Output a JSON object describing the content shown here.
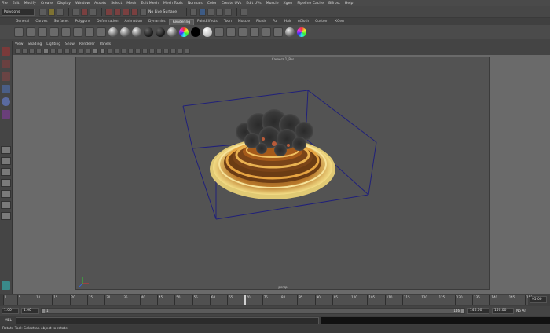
{
  "menubar": {
    "items": [
      "File",
      "Edit",
      "Modify",
      "Create",
      "Display",
      "Window",
      "Assets",
      "Select",
      "Mesh",
      "Edit Mesh",
      "Mesh Tools",
      "Normals",
      "Color",
      "Create UVs",
      "Edit UVs",
      "Muscle",
      "Xgen",
      "Pipeline Cache",
      "Bifrost",
      "Help"
    ]
  },
  "statusline": {
    "mode": "Polygons",
    "live_surface": "No Live Surface"
  },
  "shelf": {
    "tabs": [
      "General",
      "Curves",
      "Surfaces",
      "Polygons",
      "Deformation",
      "Animation",
      "Dynamics",
      "Rendering",
      "PaintEffects",
      "Toon",
      "Muscle",
      "Fluids",
      "Fur",
      "Hair",
      "nCloth",
      "Custom",
      "XGen"
    ],
    "active_tab": "Rendering"
  },
  "panel_menu": {
    "items": [
      "View",
      "Shading",
      "Lighting",
      "Show",
      "Renderer",
      "Panels"
    ]
  },
  "viewport": {
    "top_label": "Camera 1_Pos",
    "camera_name": "persp"
  },
  "time_slider": {
    "ticks": [
      "1",
      "5",
      "10",
      "15",
      "20",
      "25",
      "30",
      "35",
      "40",
      "45",
      "50",
      "55",
      "60",
      "65",
      "70",
      "75",
      "80",
      "85",
      "90",
      "95",
      "100",
      "105",
      "110",
      "115",
      "120",
      "125",
      "130",
      "135",
      "140",
      "145",
      "150"
    ],
    "current_frame_value": "95.00",
    "cursor_frame": 70
  },
  "range_slider": {
    "start": "1.00",
    "inner_start": "1.00",
    "range_start_label": "1",
    "range_end_label": "146",
    "inner_end": "146.00",
    "end": "150.00",
    "anim_layer": "No Ar"
  },
  "cmdline": {
    "label": "MEL"
  },
  "helpline": {
    "text": "Rotate Tool: Select an object to rotate."
  },
  "colors": {
    "viewport_bg": "#535353",
    "bounding_box": "#20207a",
    "accent_blue": "#3d5b85"
  }
}
